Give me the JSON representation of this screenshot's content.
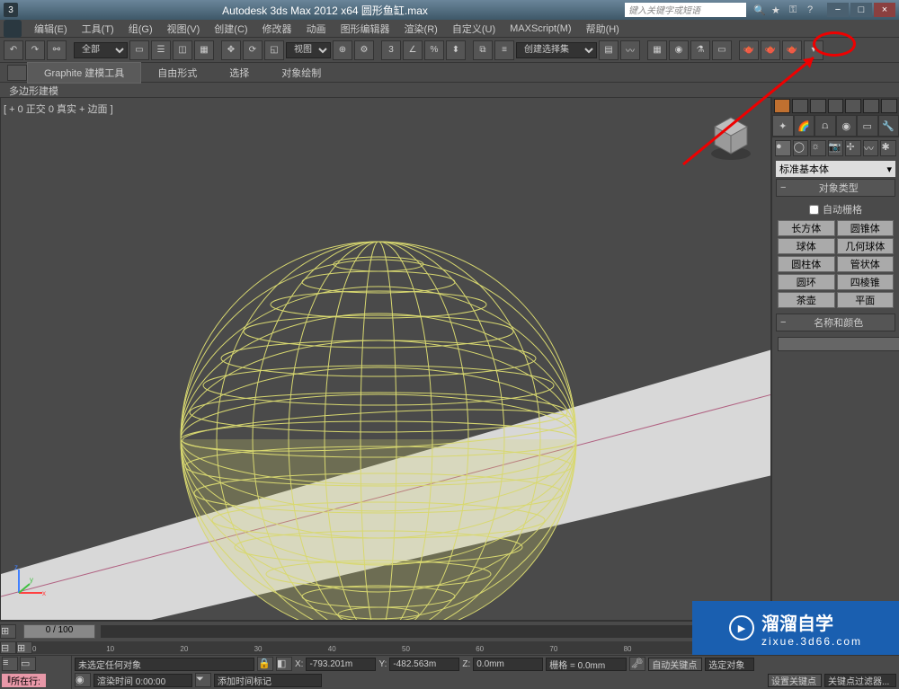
{
  "titlebar": {
    "title": "Autodesk 3ds Max 2012 x64    圆形鱼缸.max",
    "search_placeholder": "键入关键字或短语"
  },
  "menu": [
    "编辑(E)",
    "工具(T)",
    "组(G)",
    "视图(V)",
    "创建(C)",
    "修改器",
    "动画",
    "图形编辑器",
    "渲染(R)",
    "自定义(U)",
    "MAXScript(M)",
    "帮助(H)"
  ],
  "toolbar": {
    "filter": "全部",
    "viewlabel": "视图",
    "selset": "创建选择集"
  },
  "ribbon": {
    "tabs": [
      "Graphite 建模工具",
      "自由形式",
      "选择",
      "对象绘制"
    ],
    "sub": "多边形建模"
  },
  "viewport": {
    "label": "[ + 0 正交 0 真实 + 边面 ]"
  },
  "cmdpanel": {
    "dropdown": "标准基本体",
    "objtype_hdr": "对象类型",
    "autogrid": "自动栅格",
    "buttons": [
      [
        "长方体",
        "圆锥体"
      ],
      [
        "球体",
        "几何球体"
      ],
      [
        "圆柱体",
        "管状体"
      ],
      [
        "圆环",
        "四棱锥"
      ],
      [
        "茶壶",
        "平面"
      ]
    ],
    "namecolor_hdr": "名称和颜色"
  },
  "timeline": {
    "pos": "0 / 100"
  },
  "status": {
    "sel": "未选定任何对象",
    "x": "-793.201m",
    "y": "-482.563m",
    "z": "0.0mm",
    "grid": "栅格 = 0.0mm",
    "rendertime": "渲染时间  0:00:00",
    "addtag": "添加时间标记",
    "autokey": "自动关键点",
    "selkey": "选定对象",
    "setkey": "设置关键点",
    "keyfilter": "关键点过滤器...",
    "mxs": "所在行:"
  },
  "watermark": {
    "brand": "溜溜自学",
    "url": "zixue.3d66.com"
  }
}
